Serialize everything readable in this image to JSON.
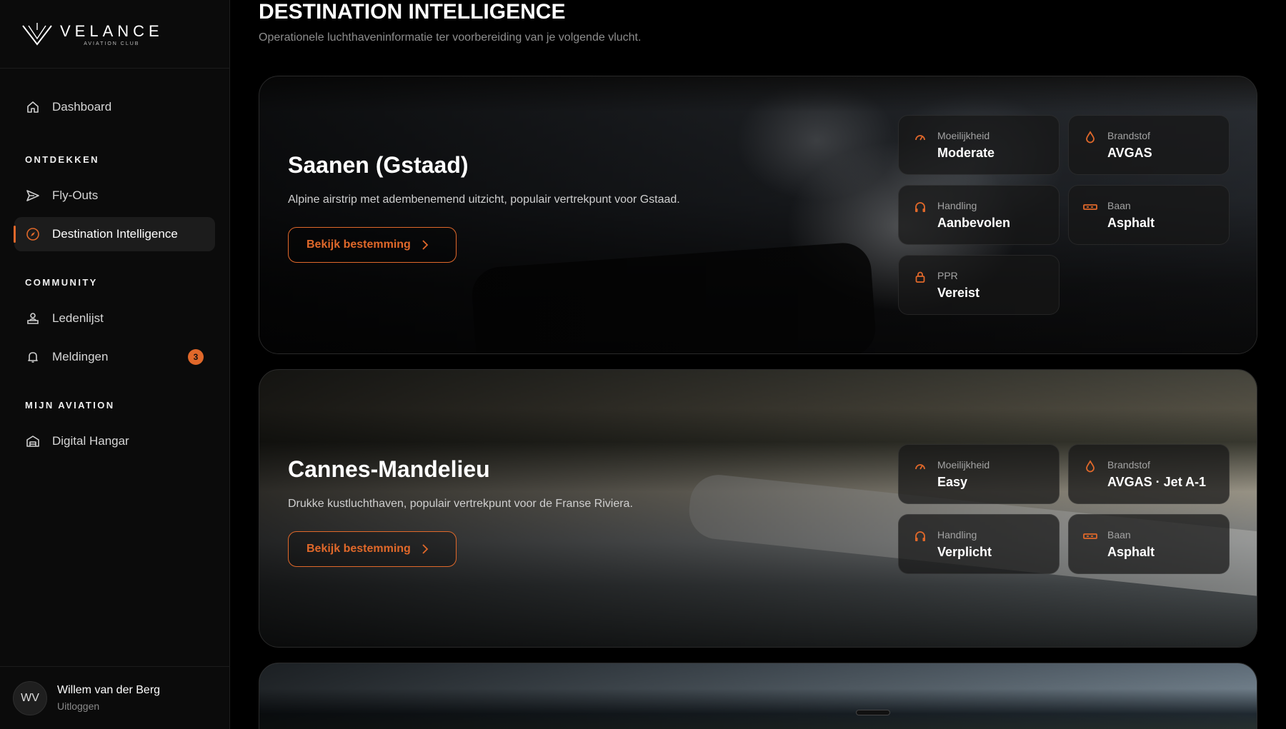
{
  "brand": {
    "name": "VELANCE",
    "tagline": "AVIATION CLUB"
  },
  "sidebar": {
    "dashboard": "Dashboard",
    "sections": {
      "discover": "ONTDEKKEN",
      "community": "COMMUNITY",
      "my_aviation": "MIJN AVIATION"
    },
    "items": {
      "flyouts": "Fly-Outs",
      "destination": "Destination Intelligence",
      "members": "Ledenlijst",
      "notifications": "Meldingen",
      "notifications_count": "3",
      "hangar": "Digital Hangar"
    },
    "user": {
      "initials": "WV",
      "name": "Willem van der Berg",
      "logout": "Uitloggen"
    }
  },
  "page": {
    "title": "DESTINATION INTELLIGENCE",
    "subtitle": "Operationele luchthaveninformatie ter voorbereiding van je volgende vlucht."
  },
  "destinations": [
    {
      "name": "Saanen (Gstaad)",
      "description": "Alpine airstrip met adembenemend uitzicht, populair vertrekpunt voor Gstaad.",
      "button": "Bekijk bestemming",
      "stats": {
        "difficulty": {
          "label": "Moeilijkheid",
          "value": "Moderate"
        },
        "fuel": {
          "label": "Brandstof",
          "value": "AVGAS"
        },
        "handling": {
          "label": "Handling",
          "value": "Aanbevolen"
        },
        "runway": {
          "label": "Baan",
          "value": "Asphalt"
        },
        "ppr": {
          "label": "PPR",
          "value": "Vereist"
        }
      }
    },
    {
      "name": "Cannes-Mandelieu",
      "description": "Drukke kustluchthaven, populair vertrekpunt voor de Franse Riviera.",
      "button": "Bekijk bestemming",
      "stats": {
        "difficulty": {
          "label": "Moeilijkheid",
          "value": "Easy"
        },
        "fuel": {
          "label": "Brandstof",
          "value": "AVGAS · Jet A-1"
        },
        "handling": {
          "label": "Handling",
          "value": "Verplicht"
        },
        "runway": {
          "label": "Baan",
          "value": "Asphalt"
        }
      }
    }
  ],
  "colors": {
    "accent": "#e0682a",
    "background": "#000000",
    "sidebar": "#0b0b0b"
  }
}
